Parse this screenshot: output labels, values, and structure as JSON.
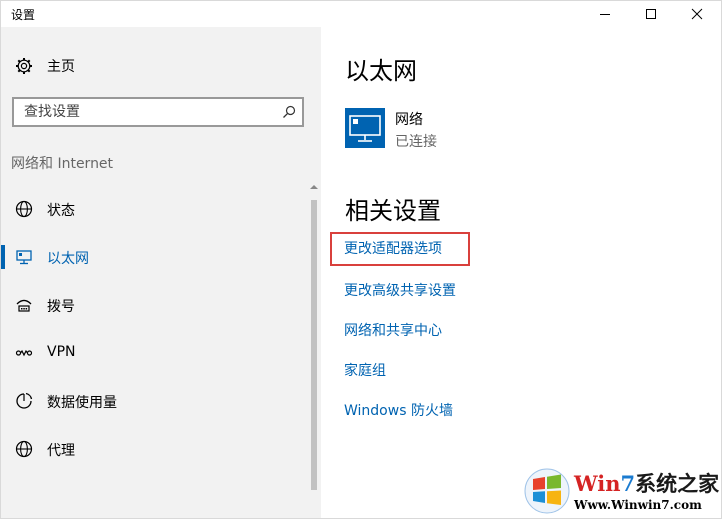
{
  "window": {
    "title": "设置",
    "controls": [
      "minimize-icon",
      "maximize-icon",
      "close-icon"
    ]
  },
  "sidebar": {
    "home_label": "主页",
    "home_icon": "gear-icon",
    "search_placeholder": "查找设置",
    "section_title": "网络和 Internet",
    "items": [
      {
        "label": "状态",
        "icon": "globe-icon",
        "active": false
      },
      {
        "label": "以太网",
        "icon": "ethernet-icon",
        "active": true
      },
      {
        "label": "拨号",
        "icon": "dialup-icon",
        "active": false
      },
      {
        "label": "VPN",
        "icon": "vpn-icon",
        "active": false
      },
      {
        "label": "数据使用量",
        "icon": "data-usage-icon",
        "active": false
      },
      {
        "label": "代理",
        "icon": "globe-icon",
        "active": false
      }
    ]
  },
  "main": {
    "title": "以太网",
    "network": {
      "name": "网络",
      "status": "已连接",
      "icon": "monitor-icon"
    },
    "related_title": "相关设置",
    "links": [
      {
        "label": "更改适配器选项",
        "highlighted": true
      },
      {
        "label": "更改高级共享设置",
        "highlighted": false
      },
      {
        "label": "网络和共享中心",
        "highlighted": false
      },
      {
        "label": "家庭组",
        "highlighted": false
      },
      {
        "label": "Windows 防火墙",
        "highlighted": false
      }
    ]
  },
  "watermark": {
    "part1": "Win",
    "part2": "7",
    "part3": "系统之家",
    "url": "Www.Winwin7.com"
  },
  "colors": {
    "accent": "#0063b1",
    "highlight_border": "#d9403c",
    "sidebar_bg": "#f2f2f2"
  }
}
